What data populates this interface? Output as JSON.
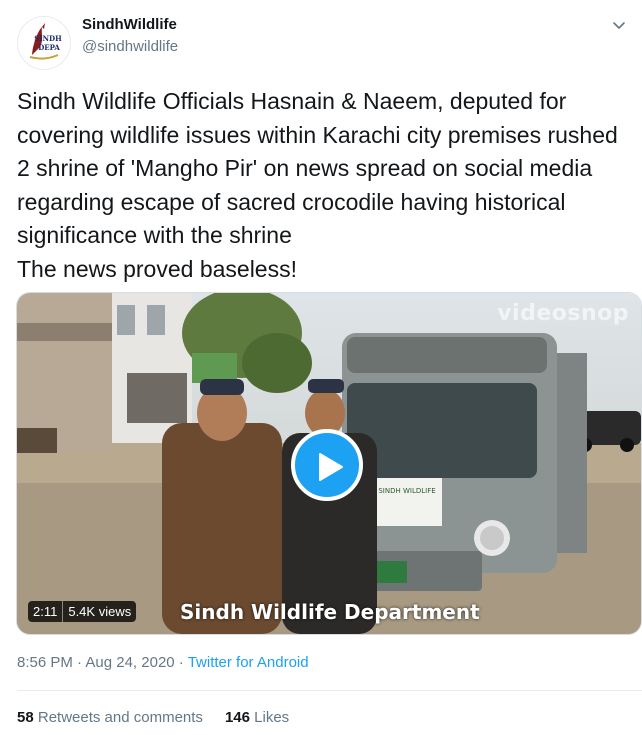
{
  "colors": {
    "accent": "#1da1f2",
    "secondary_text": "#657786",
    "primary_text": "#14171a"
  },
  "account": {
    "display_name": "SindhWildlife",
    "handle": "@sindhwildlife",
    "avatar_logo": {
      "line1": "SINDH",
      "line2": "DEPA"
    }
  },
  "tweet": {
    "text": "Sindh Wildlife Officials Hasnain & Naeem, deputed for covering wildlife issues within Karachi city premises rushed 2 shrine of 'Mangho Pir' on news spread on social media regarding escape of sacred crocodile having historical significance with the shrine\nThe news proved baseless!"
  },
  "video": {
    "watermark": "videosnop",
    "caption": "Sindh Wildlife Department",
    "duration": "2:11",
    "views": "5.4K views",
    "vehicle_sign": "SINDH WILDLIFE"
  },
  "meta": {
    "time": "8:56 PM",
    "separator": " · ",
    "date": "Aug 24, 2020",
    "source": "Twitter for Android"
  },
  "stats": {
    "retweets_count": "58",
    "retweets_label": "Retweets and comments",
    "likes_count": "146",
    "likes_label": "Likes"
  },
  "icons": [
    "chevron-down-icon",
    "play-icon"
  ]
}
